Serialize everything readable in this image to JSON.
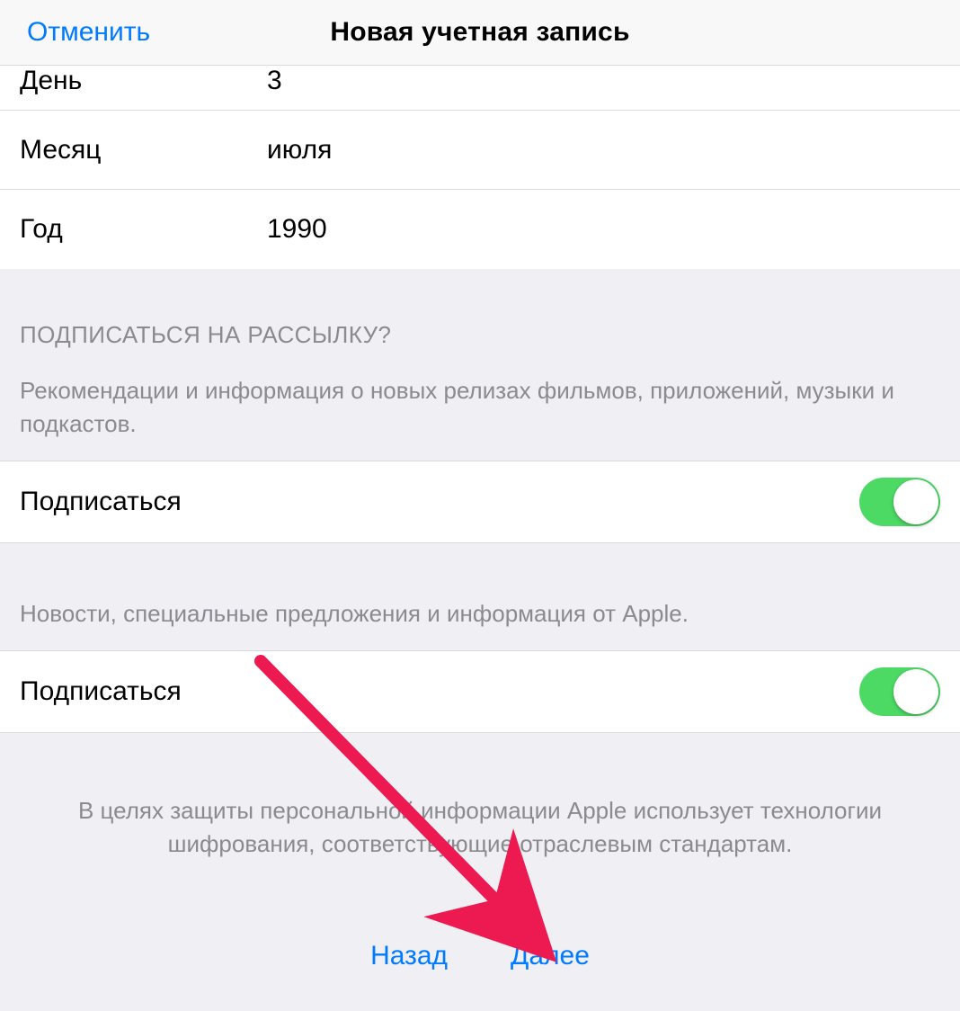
{
  "header": {
    "cancel": "Отменить",
    "title": "Новая учетная запись"
  },
  "date": {
    "day_label": "День",
    "day_value": "3",
    "month_label": "Месяц",
    "month_value": "июля",
    "year_label": "Год",
    "year_value": "1990"
  },
  "subscribe_section": {
    "header": "ПОДПИСАТЬСЯ НА РАССЫЛКУ?",
    "desc1": "Рекомендации и информация о новых релизах фильмов, приложений, музыки и подкастов.",
    "row1_label": "Подписаться",
    "row1_on": true,
    "desc2": "Новости, специальные предложения и информация от Apple.",
    "row2_label": "Подписаться",
    "row2_on": true
  },
  "privacy_text": "В целях защиты персональной информации Apple использует технологии шифрования, соответствующие отраслевым стандартам.",
  "footer": {
    "back": "Назад",
    "next": "Далее"
  }
}
